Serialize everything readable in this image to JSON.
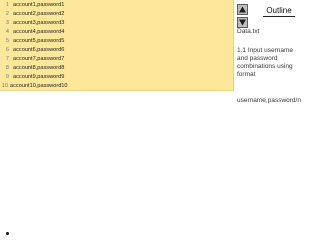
{
  "editor": {
    "lines": [
      {
        "num": "1",
        "text": "account1,password1"
      },
      {
        "num": "2",
        "text": "account2,password2"
      },
      {
        "num": "3",
        "text": "account3,password3"
      },
      {
        "num": "4",
        "text": "account4,password4"
      },
      {
        "num": "5",
        "text": "account5,password5"
      },
      {
        "num": "6",
        "text": "account6,password6"
      },
      {
        "num": "7",
        "text": "account7,password7"
      },
      {
        "num": "8",
        "text": "account8,password8"
      },
      {
        "num": "9",
        "text": "account9,password9"
      },
      {
        "num": "10",
        "text": "account10,password10"
      }
    ],
    "background": "#fde79a"
  },
  "outline": {
    "title": "Outline",
    "scroll_up_icon": "triangle-up-icon",
    "scroll_down_icon": "triangle-down-icon",
    "file_name": "Data.txt",
    "description_lines": [
      "1.1 Input username",
      "and password",
      "combinations using",
      "format"
    ],
    "format_text": "username,password/n"
  }
}
